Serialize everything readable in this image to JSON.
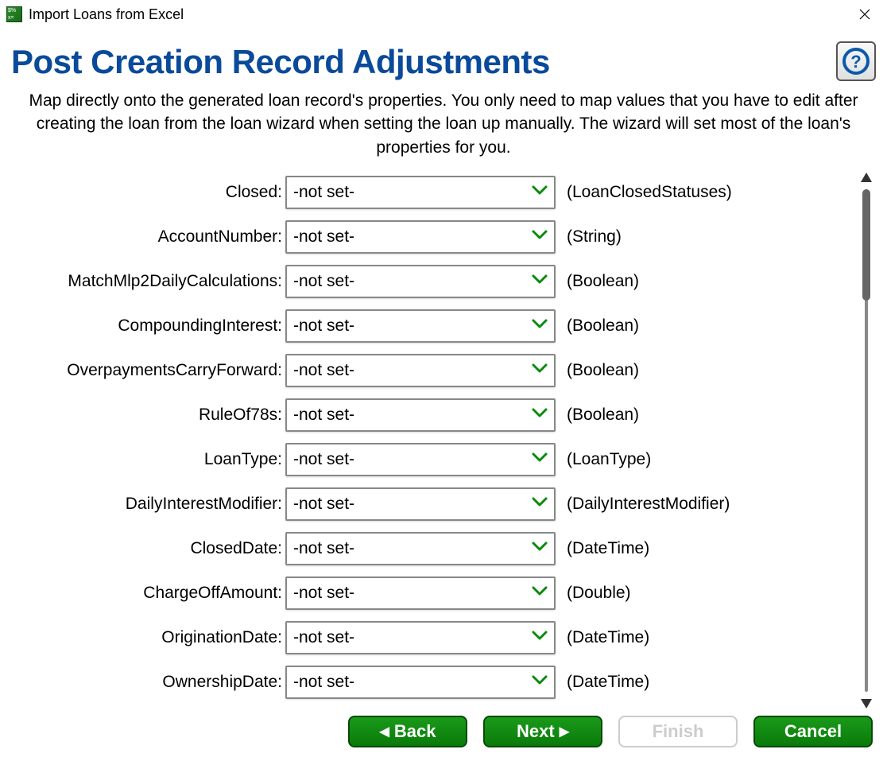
{
  "window": {
    "title": "Import Loans from Excel"
  },
  "page": {
    "title": "Post Creation Record Adjustments",
    "description": "Map directly onto the generated loan record's properties. You only need to map values that you have to edit after creating the loan from the loan wizard when setting the loan up manually. The wizard will set most of the loan's properties for you."
  },
  "fields": [
    {
      "label": "Closed:",
      "value": "-not set-",
      "type": "(LoanClosedStatuses)"
    },
    {
      "label": "AccountNumber:",
      "value": "-not set-",
      "type": "(String)"
    },
    {
      "label": "MatchMlp2DailyCalculations:",
      "value": "-not set-",
      "type": "(Boolean)"
    },
    {
      "label": "CompoundingInterest:",
      "value": "-not set-",
      "type": "(Boolean)"
    },
    {
      "label": "OverpaymentsCarryForward:",
      "value": "-not set-",
      "type": "(Boolean)"
    },
    {
      "label": "RuleOf78s:",
      "value": "-not set-",
      "type": "(Boolean)"
    },
    {
      "label": "LoanType:",
      "value": "-not set-",
      "type": "(LoanType)"
    },
    {
      "label": "DailyInterestModifier:",
      "value": "-not set-",
      "type": "(DailyInterestModifier)"
    },
    {
      "label": "ClosedDate:",
      "value": "-not set-",
      "type": "(DateTime)"
    },
    {
      "label": "ChargeOffAmount:",
      "value": "-not set-",
      "type": "(Double)"
    },
    {
      "label": "OriginationDate:",
      "value": "-not set-",
      "type": "(DateTime)"
    },
    {
      "label": "OwnershipDate:",
      "value": "-not set-",
      "type": "(DateTime)"
    }
  ],
  "buttons": {
    "back": "Back",
    "next": "Next",
    "finish": "Finish",
    "cancel": "Cancel"
  }
}
